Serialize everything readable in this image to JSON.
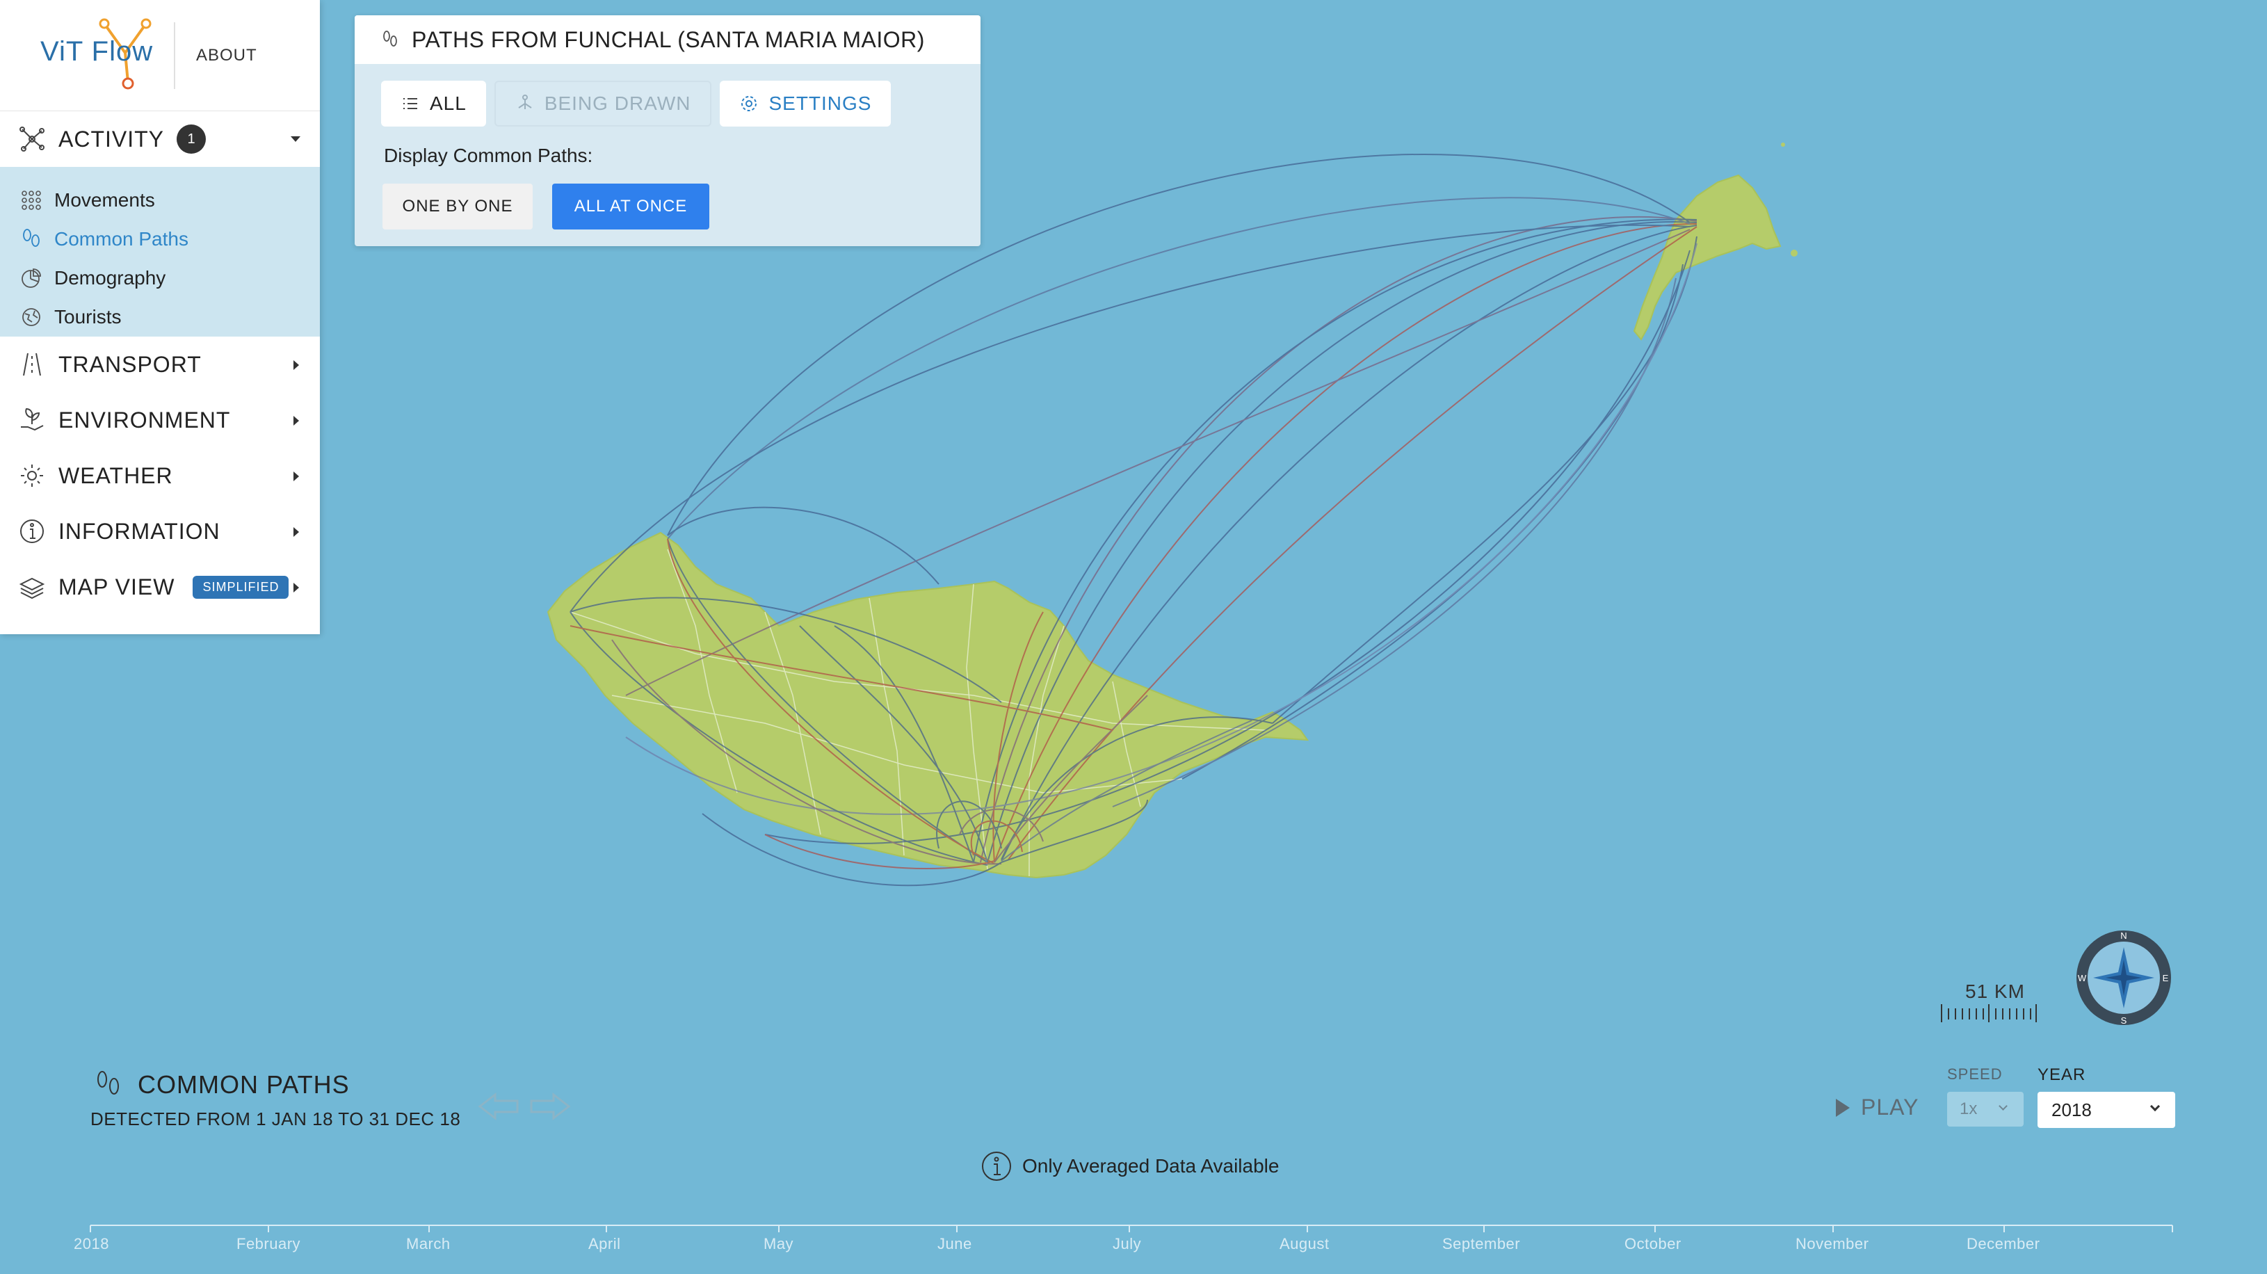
{
  "app": {
    "logo_text": "ViT Flow",
    "about_label": "ABOUT"
  },
  "sidebar": {
    "activity": {
      "label": "ACTIVITY",
      "badge": "1"
    },
    "sub_items": [
      {
        "label": "Movements",
        "icon": "grid-dots-icon",
        "active": false
      },
      {
        "label": "Common Paths",
        "icon": "footsteps-icon",
        "active": true
      },
      {
        "label": "Demography",
        "icon": "pie-chart-icon",
        "active": false
      },
      {
        "label": "Tourists",
        "icon": "globe-icon",
        "active": false
      }
    ],
    "transport": {
      "label": "TRANSPORT",
      "icon": "road-icon"
    },
    "environment": {
      "label": "ENVIRONMENT",
      "icon": "plant-hand-icon"
    },
    "weather": {
      "label": "WEATHER",
      "icon": "sun-icon"
    },
    "information": {
      "label": "INFORMATION",
      "icon": "info-icon"
    },
    "map_view": {
      "label": "MAP VIEW",
      "tag": "SIMPLIFIED",
      "icon": "layers-icon"
    }
  },
  "panel": {
    "title": "PATHS FROM FUNCHAL (SANTA MARIA MAIOR)",
    "tabs": {
      "all": "ALL",
      "being_drawn": "BEING DRAWN",
      "settings": "SETTINGS"
    },
    "display_label": "Display Common Paths:",
    "one_by_one": "ONE BY ONE",
    "all_at_once": "ALL AT ONCE",
    "selected_mode": "ALL AT ONCE"
  },
  "bottom": {
    "title": "COMMON PATHS",
    "subtitle": "DETECTED FROM 1 JAN 18 TO 31 DEC 18",
    "info_note": "Only Averaged Data Available",
    "play_label": "PLAY",
    "speed_label": "SPEED",
    "speed_value": "1x",
    "year_label": "YEAR",
    "year_value": "2018"
  },
  "map": {
    "scale_label": "51 KM",
    "compass": {
      "n": "N",
      "s": "S",
      "e": "E",
      "w": "W"
    },
    "colors": {
      "sea": "#72b8d6",
      "land": "#b5cc6a",
      "path_blue": "#3f5c8c",
      "path_red": "#b04a44"
    }
  },
  "timeline": {
    "months": [
      "2018",
      "February",
      "March",
      "April",
      "May",
      "June",
      "July",
      "August",
      "September",
      "October",
      "November",
      "December"
    ]
  }
}
